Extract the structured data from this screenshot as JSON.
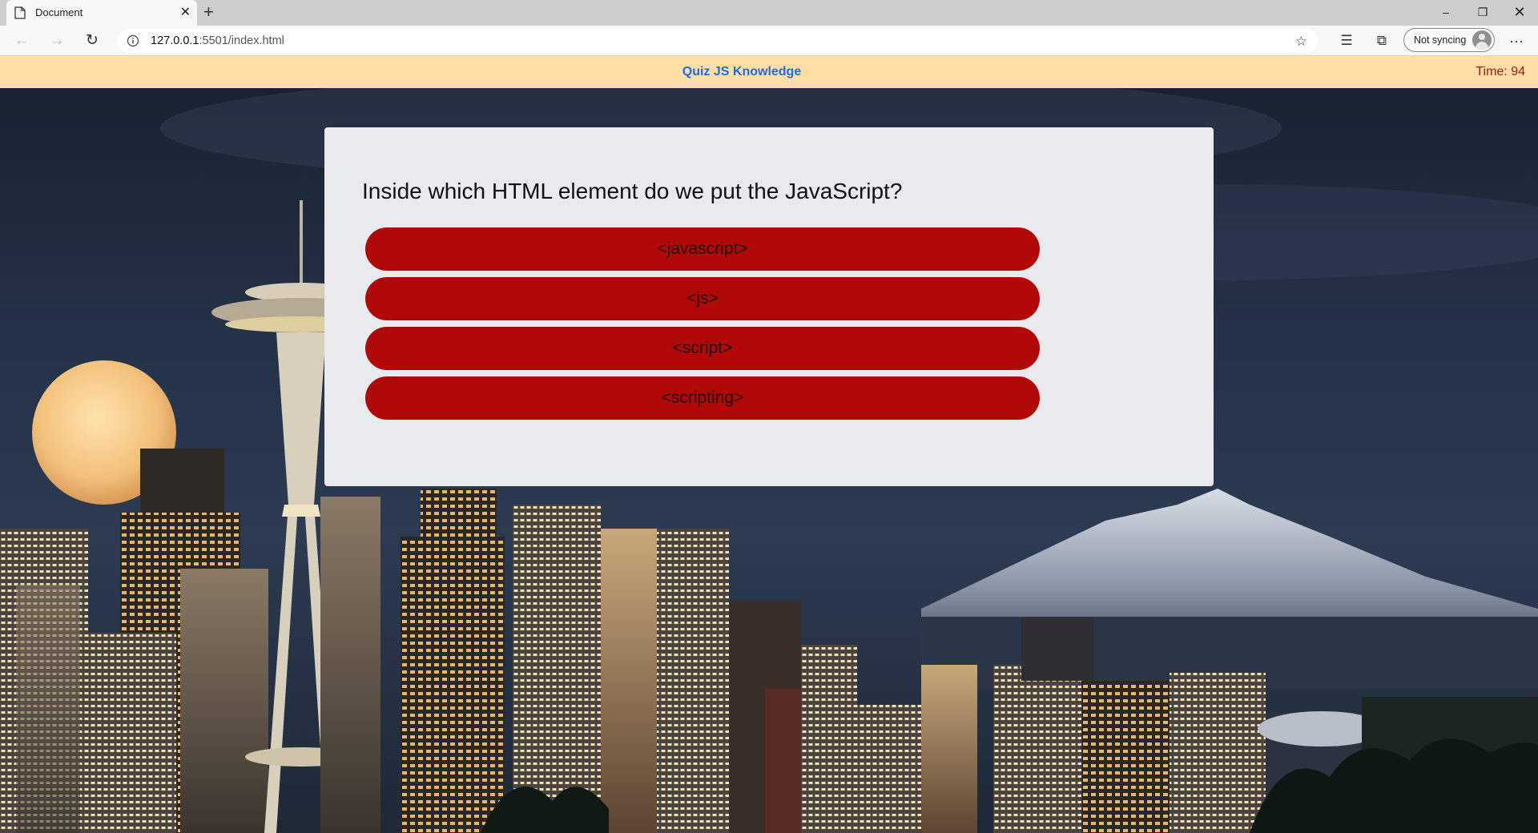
{
  "browser": {
    "tab_title": "Document",
    "url_host": "127.0.0.1",
    "url_rest": ":5501/index.html",
    "sync_label": "Not syncing",
    "icons": [
      "document-icon",
      "close-icon",
      "plus-icon",
      "back-icon",
      "forward-icon",
      "reload-icon",
      "info-icon",
      "star-icon",
      "favorites-icon",
      "collections-icon",
      "avatar",
      "more-icon"
    ]
  },
  "header": {
    "title": "Quiz JS Knowledge",
    "time": "Time: 94",
    "background": "#ffdda6",
    "title_color": "#1b6ee0",
    "time_color": "#9b1b0c"
  },
  "quiz": {
    "question": "Inside which HTML element do we put the JavaScript?",
    "answers": [
      "<javascript>",
      "<js>",
      "<script>",
      "<scripting>"
    ],
    "answer_color": "#b10808",
    "card_color": "#e8eaed"
  }
}
